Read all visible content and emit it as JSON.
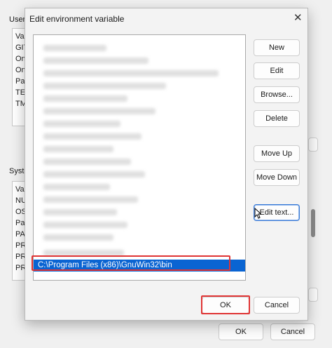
{
  "background": {
    "user_section_label": "User",
    "user_rows": [
      "Va",
      "GIT",
      "On",
      "On",
      "Pat",
      "TEN",
      "TM"
    ],
    "system_section_label": "Syste",
    "system_rows": [
      "Va",
      "NU",
      "OS",
      "Pat",
      "PA",
      "PR",
      "PR",
      "PR",
      "PR"
    ],
    "ok_label": "OK",
    "cancel_label": "Cancel"
  },
  "dialog": {
    "title": "Edit environment variable",
    "close_glyph": "✕",
    "selected_entry": "C:\\Program Files (x86)\\GnuWin32\\bin",
    "buttons": {
      "new": "New",
      "edit": "Edit",
      "browse": "Browse...",
      "delete": "Delete",
      "move_up": "Move Up",
      "move_down": "Move Down",
      "edit_text": "Edit text..."
    },
    "ok_label": "OK",
    "cancel_label": "Cancel"
  },
  "colors": {
    "selection": "#0a64d2",
    "highlight_box": "#e03434"
  },
  "icons": {
    "close": "close-icon",
    "cursor": "mouse-pointer-icon"
  }
}
